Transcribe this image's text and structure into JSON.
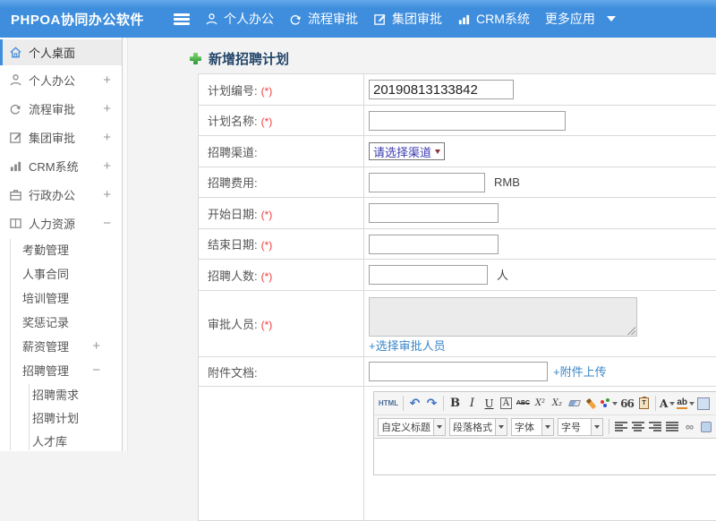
{
  "topbar": {
    "logo": "PHPOA协同办公软件",
    "nav": [
      {
        "label": "个人办公"
      },
      {
        "label": "流程审批"
      },
      {
        "label": "集团审批"
      },
      {
        "label": "CRM系统"
      },
      {
        "label": "更多应用"
      }
    ]
  },
  "sidebar": {
    "items": [
      {
        "label": "个人桌面",
        "expand": ""
      },
      {
        "label": "个人办公",
        "expand": "+"
      },
      {
        "label": "流程审批",
        "expand": "+"
      },
      {
        "label": "集团审批",
        "expand": "+"
      },
      {
        "label": "CRM系统",
        "expand": "+"
      },
      {
        "label": "行政办公",
        "expand": "+"
      },
      {
        "label": "人力资源",
        "expand": "−"
      }
    ],
    "hr_children": [
      {
        "label": "考勤管理",
        "expand": ""
      },
      {
        "label": "人事合同",
        "expand": ""
      },
      {
        "label": "培训管理",
        "expand": ""
      },
      {
        "label": "奖惩记录",
        "expand": ""
      },
      {
        "label": "薪资管理",
        "expand": "+"
      },
      {
        "label": "招聘管理",
        "expand": "−"
      }
    ],
    "recruit_children": [
      {
        "label": "招聘需求"
      },
      {
        "label": "招聘计划"
      },
      {
        "label": "人才库"
      }
    ]
  },
  "page": {
    "title": "新增招聘计划"
  },
  "form": {
    "required_marker": "(*)",
    "rows": [
      {
        "label": "计划编号:",
        "value": "20190813133842"
      },
      {
        "label": "计划名称:"
      },
      {
        "label": "招聘渠道:",
        "select_placeholder": "请选择渠道"
      },
      {
        "label": "招聘费用:",
        "suffix": "RMB"
      },
      {
        "label": "开始日期:"
      },
      {
        "label": "结束日期:"
      },
      {
        "label": "招聘人数:",
        "suffix": "人"
      },
      {
        "label": "审批人员:",
        "link": "+选择审批人员"
      },
      {
        "label": "附件文档:",
        "link": "+附件上传"
      }
    ]
  },
  "editor": {
    "html_btn": "HTML",
    "undo": "↶",
    "redo": "↷",
    "bold": "B",
    "italic": "I",
    "underline": "U",
    "boxed_a": "A",
    "strike": "ABC",
    "sup": "X²",
    "sub": "X₂",
    "quote": "66",
    "font_color": "A",
    "highlight": "ab",
    "selects": [
      "自定义标题",
      "段落格式",
      "字体",
      "字号"
    ]
  }
}
